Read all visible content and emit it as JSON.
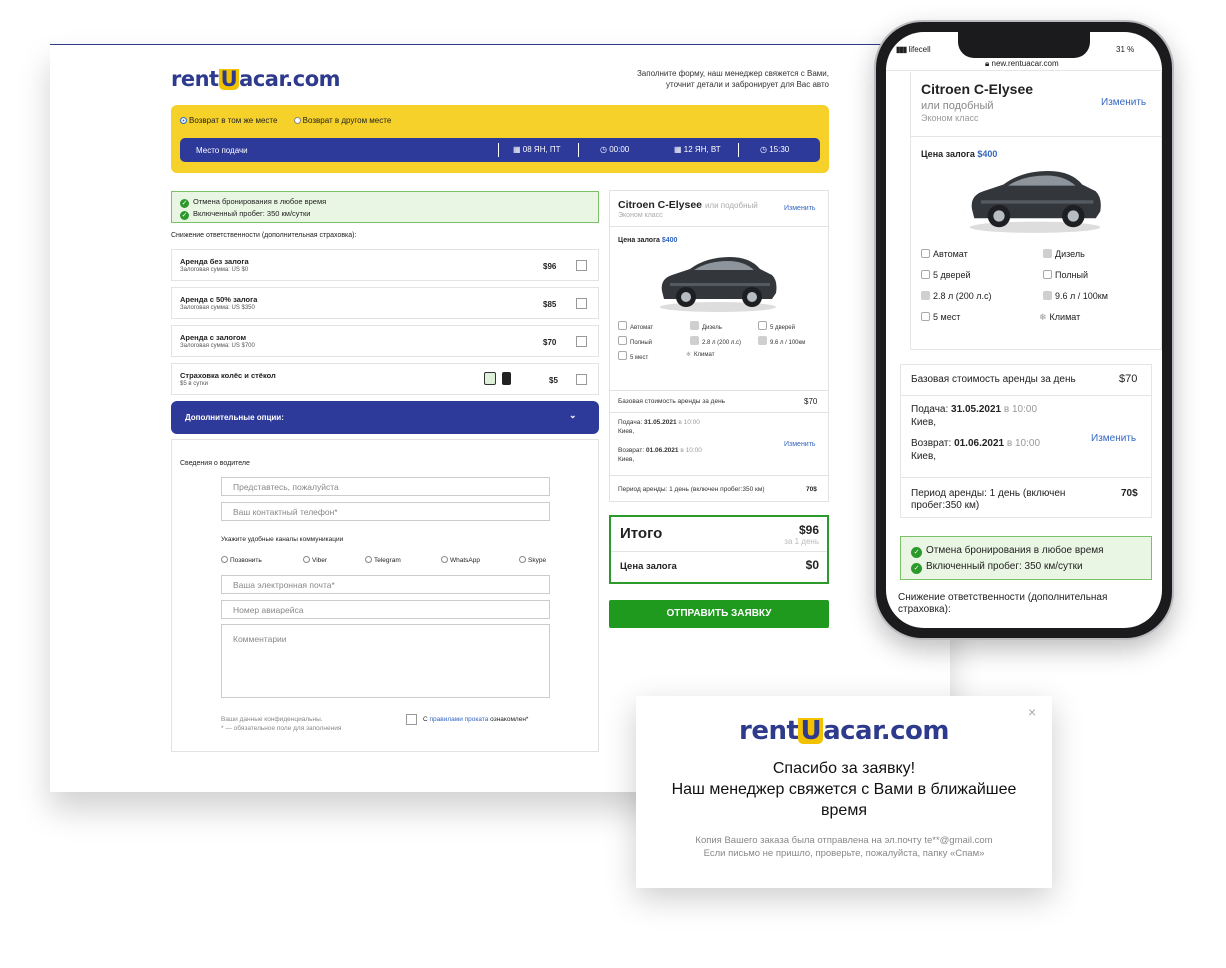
{
  "brand": {
    "logo_a": "rent",
    "logo_u": "U",
    "logo_b": "acar.com"
  },
  "desktop": {
    "hint_1": "Заполните форму, наш менеджер свяжется с Вами,",
    "hint_2": "уточнит детали и забронирует для Вас авто",
    "return_same": "Возврат в том же месте",
    "return_other": "Возврат в другом месте",
    "pickup_place": "Место подачи",
    "date_from": "08 ЯН, ПТ",
    "time_from": "00:00",
    "date_to": "12 ЯН, ВТ",
    "time_to": "15:30",
    "benefit_1": "Отмена бронирования в любое время",
    "benefit_2": "Включенный пробег: 350 км/сутки",
    "insurance_title": "Снижение ответственности (дополнительная страховка):",
    "options": [
      {
        "title": "Аренда без залога",
        "sub": "Залоговая сумма: US $0",
        "price": "$96"
      },
      {
        "title": "Аренда с 50% залога",
        "sub": "Залоговая сумма: US $350",
        "price": "$85"
      },
      {
        "title": "Аренда с залогом",
        "sub": "Залоговая сумма: US $700",
        "price": "$70"
      },
      {
        "title": "Страховка колёс и стёкол",
        "sub": "$5 в сутки",
        "price": "$5"
      }
    ],
    "extra_options": "Дополнительные опции:",
    "driver_info": "Сведения о водителе",
    "name_ph": "Представтесь, пожалуйста",
    "phone_ph": "Ваш контактный телефон*",
    "channels_title": "Укажите удобные каналы коммуникации",
    "channels": [
      "Позвонить",
      "Viber",
      "Telegram",
      "WhatsApp",
      "Skype"
    ],
    "email_ph": "Ваша электронная почта*",
    "flight_ph": "Номер авиарейса",
    "comment_ph": "Комментарии",
    "privacy_1": "Ваши данные конфиденциальны.",
    "privacy_2": "* — обязательное поле для заполнения",
    "agree_a": "С ",
    "agree_link": "правилами проката",
    "agree_b": " ознакомлен*",
    "car_name": "Citroen C-Elysee",
    "car_similar": "или подобный",
    "car_class": "Эконом класс",
    "change": "Изменить",
    "deposit_label": "Цена залога",
    "deposit_value": "$400",
    "specs": [
      "Автомат",
      "Дизель",
      "5 дверей",
      "Полный",
      "2.8 л (200 л.с)",
      "9.6 л / 100км",
      "5 мест",
      "Климат"
    ],
    "base_label": "Базовая стоимость аренды за день",
    "base_value": "$70",
    "pickup_label": "Подача: ",
    "pickup_date": "31.05.2021",
    "pickup_time": " в 10:00",
    "pickup_city": "Киев,",
    "return_label": "Возврат: ",
    "return_date": "01.06.2021",
    "return_time": " в 10:00",
    "return_city": "Киев,",
    "period": "Период аренды: 1 день (включен пробег:350 км)",
    "period_value": "70$",
    "total_label": "Итого",
    "total_value": "$96",
    "total_per": "за 1 день",
    "deposit_total_label": "Цена залога",
    "deposit_total_value": "$0",
    "submit": "ОТПРАВИТЬ ЗАЯВКУ"
  },
  "phone": {
    "carrier": "lifecell",
    "url": "new.rentuacar.com",
    "battery": "31 %",
    "car_name": "Citroen C-Elysee",
    "car_similar": "или подобный",
    "car_class": "Эконом класс",
    "change": "Изменить",
    "deposit_label": "Цена залога ",
    "deposit_value": "$400",
    "specs": [
      "Автомат",
      "Дизель",
      "5 дверей",
      "Полный",
      "2.8 л (200 л.с)",
      "9.6 л / 100км",
      "5 мест",
      "Климат"
    ],
    "base_label": "Базовая стоимость аренды за день",
    "base_value": "$70",
    "pickup_label": "Подача: ",
    "pickup_date": "31.05.2021",
    "pickup_time": " в 10:00",
    "pickup_city": "Киев,",
    "return_label": "Возврат: ",
    "return_date": "01.06.2021",
    "return_time": " в 10:00",
    "return_city": "Киев,",
    "period_1": "Период аренды: 1 день (включен",
    "period_2": "пробег:350 км)",
    "period_value": "70$",
    "benefit_1": "Отмена бронирования в любое время",
    "benefit_2": "Включенный пробег: 350 км/сутки",
    "insurance_1": "Снижение ответственности (дополнительная",
    "insurance_2": "страховка):"
  },
  "popup": {
    "thanks": "Спасибо за заявку!",
    "msg_1": "Наш менеджер свяжется с Вами в ближайшее",
    "msg_2": "время",
    "copy_1": "Копия Вашего заказа была отправлена на эл.почту te**@gmail.com",
    "copy_2": "Если письмо не пришло, проверьте, пожалуйста, папку «Спам»"
  }
}
